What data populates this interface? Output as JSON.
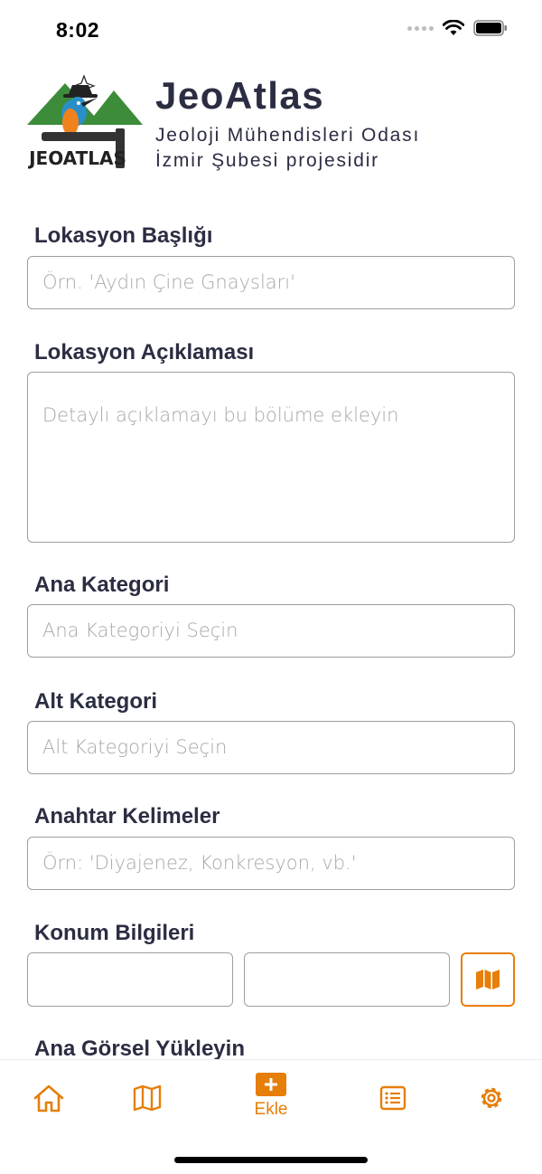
{
  "status_bar": {
    "time": "8:02"
  },
  "header": {
    "logo_text": "JEOATLAS",
    "title": "JeoAtlas",
    "subtitle_line1": "Jeoloji Mühendisleri Odası",
    "subtitle_line2": "İzmir Şubesi projesidir"
  },
  "form": {
    "title_label": "Lokasyon Başlığı",
    "title_placeholder": "Örn. 'Aydın Çine Gnaysları'",
    "description_label": "Lokasyon Açıklaması",
    "description_placeholder": "Detaylı açıklamayı bu bölüme ekleyin",
    "main_category_label": "Ana Kategori",
    "main_category_placeholder": "Ana Kategoriyi Seçin",
    "sub_category_label": "Alt Kategori",
    "sub_category_placeholder": "Alt Kategoriyi Seçin",
    "keywords_label": "Anahtar Kelimeler",
    "keywords_placeholder": "Örn: 'Diyajenez, Konkresyon, vb.'",
    "location_label": "Konum Bilgileri",
    "image_label": "Ana Görsel Yükleyin"
  },
  "tab_bar": {
    "add_label": "Ekle",
    "icons": [
      "home-icon",
      "map-icon",
      "add-icon",
      "list-icon",
      "gear-icon"
    ]
  },
  "colors": {
    "accent": "#e67e0a",
    "text": "#2b2d42",
    "logo_green": "#3d8c3a"
  }
}
